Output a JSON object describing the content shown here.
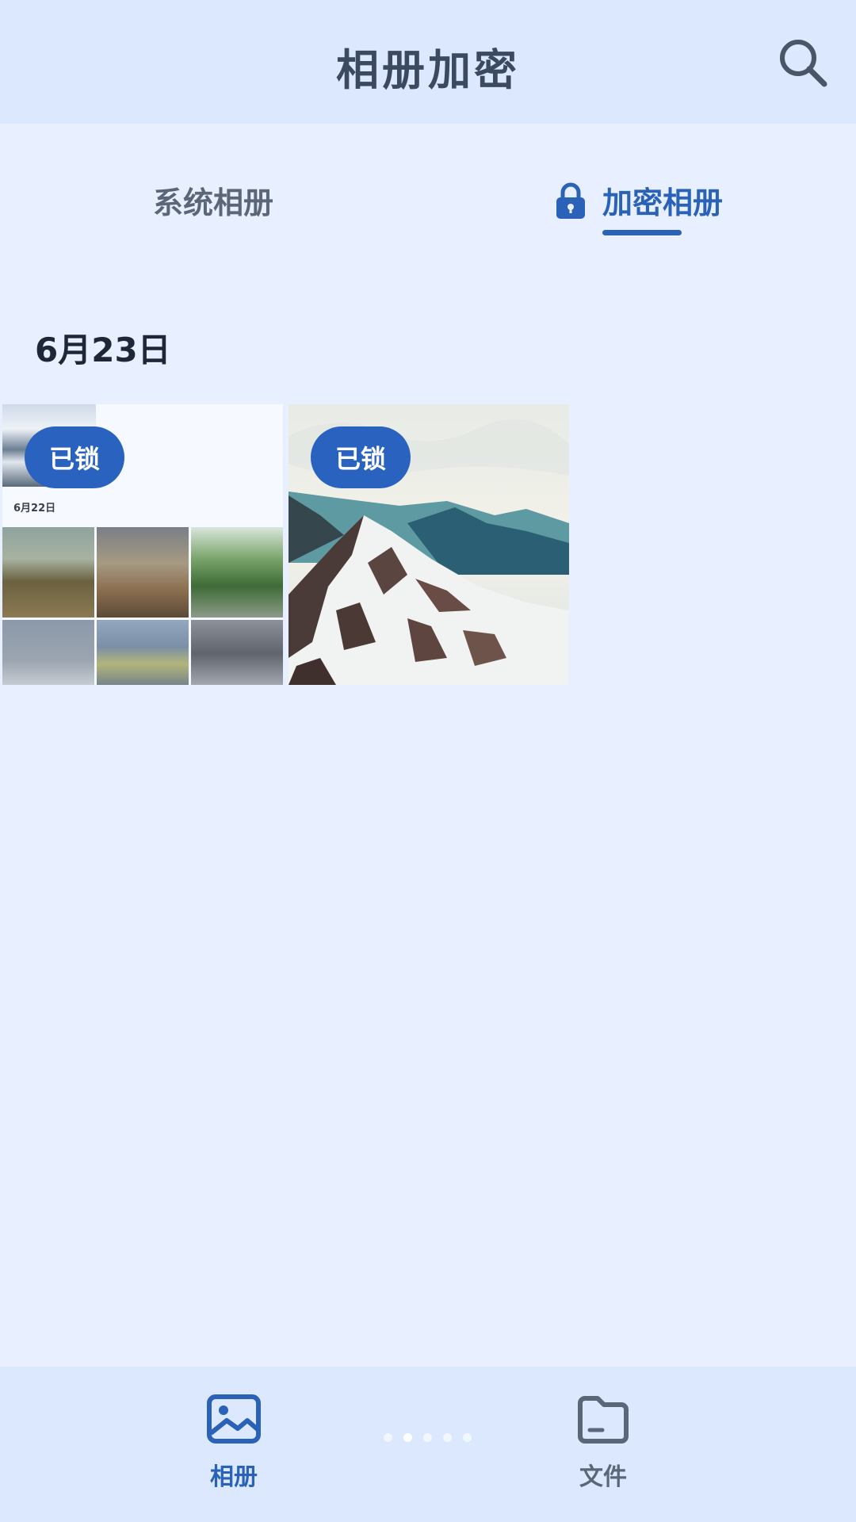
{
  "header": {
    "title": "相册加密"
  },
  "tabs": [
    {
      "label": "系统相册",
      "active": false
    },
    {
      "label": "加密相册",
      "active": true
    }
  ],
  "date_group": {
    "date": "6月23日"
  },
  "photos": [
    {
      "badge": "已锁",
      "thumb_date": "6月22日"
    },
    {
      "badge": "已锁"
    }
  ],
  "bottom_nav": [
    {
      "label": "相册",
      "icon": "image-icon",
      "active": true
    },
    {
      "label": "文件",
      "icon": "folder-icon",
      "active": false
    }
  ],
  "colors": {
    "accent": "#2a62b8",
    "background": "#e8f0ff",
    "header_bg": "#dce8fd"
  }
}
